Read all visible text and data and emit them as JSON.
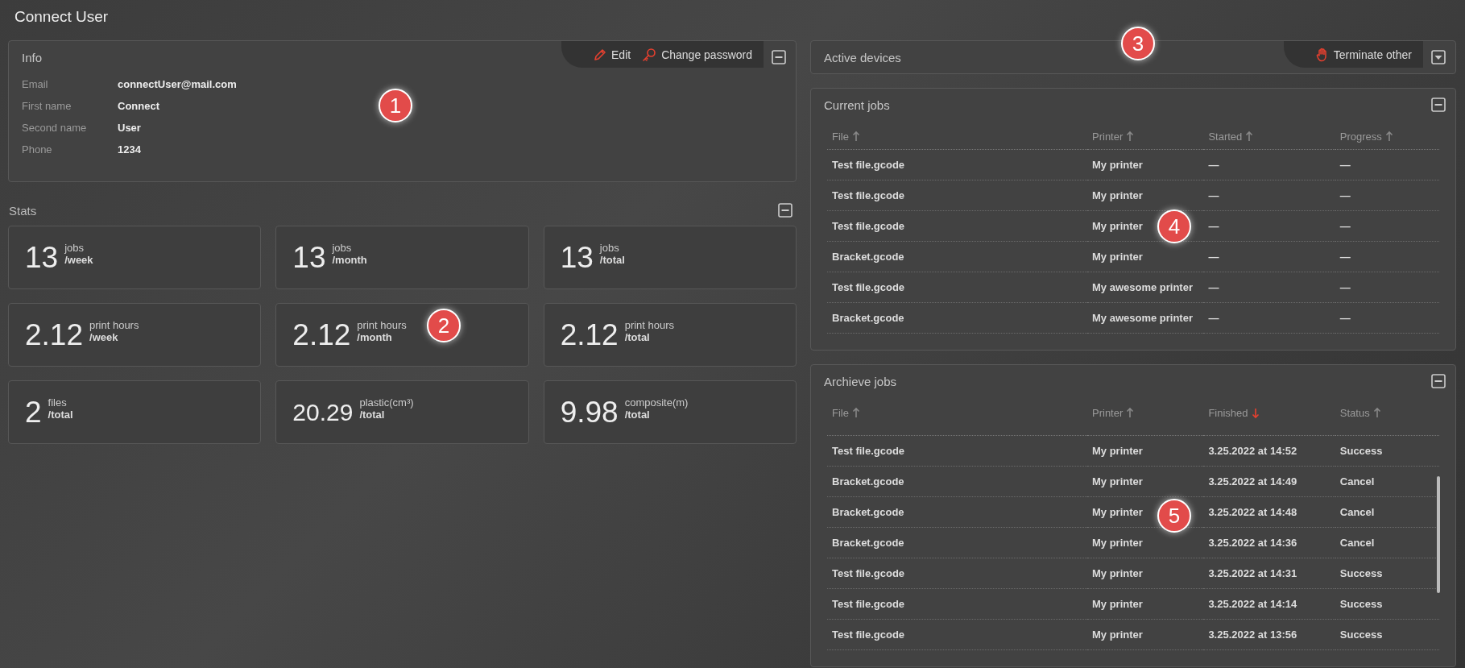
{
  "page": {
    "title": "Connect User"
  },
  "info": {
    "title": "Info",
    "callout": "1",
    "actions": [
      {
        "kind": "edit",
        "label": "Edit"
      },
      {
        "kind": "password",
        "label": "Change password"
      }
    ],
    "expanded": true,
    "fields": [
      {
        "label": "Email",
        "value": "connectUser@mail.com"
      },
      {
        "label": "First name",
        "value": "Connect"
      },
      {
        "label": "Second name",
        "value": "User"
      },
      {
        "label": "Phone",
        "value": "1234"
      }
    ]
  },
  "stats": {
    "title": "Stats",
    "callout": "2",
    "expanded": true,
    "cards": [
      {
        "value": "13",
        "unit": "jobs",
        "period": "/week"
      },
      {
        "value": "13",
        "unit": "jobs",
        "period": "/month"
      },
      {
        "value": "13",
        "unit": "jobs",
        "period": "/total"
      },
      {
        "value": "2.12",
        "unit": "print hours",
        "period": "/week"
      },
      {
        "value": "2.12",
        "unit": "print hours",
        "period": "/month"
      },
      {
        "value": "2.12",
        "unit": "print hours",
        "period": "/total"
      },
      {
        "value": "2",
        "unit": "files",
        "period": "/total"
      },
      {
        "value": "20.29",
        "unit": "plastic(cm³)",
        "period": "/total",
        "small": true
      },
      {
        "value": "9.98",
        "unit": "composite(m)",
        "period": "/total"
      }
    ]
  },
  "active_devices": {
    "title": "Active devices",
    "callout": "3",
    "expanded": false,
    "actions": [
      {
        "kind": "terminate",
        "label": "Terminate other"
      }
    ]
  },
  "current_jobs": {
    "title": "Current jobs",
    "callout": "4",
    "expanded": true,
    "columns": [
      {
        "label": "File",
        "descending": false,
        "sort_active": false
      },
      {
        "label": "Printer",
        "descending": false,
        "sort_active": false
      },
      {
        "label": "Started",
        "descending": false,
        "sort_active": false
      },
      {
        "label": "Progress",
        "descending": false,
        "sort_active": false
      }
    ],
    "rows": [
      [
        "Test file.gcode",
        "My printer",
        "—",
        "—"
      ],
      [
        "Test file.gcode",
        "My printer",
        "—",
        "—"
      ],
      [
        "Test file.gcode",
        "My printer",
        "—",
        "—"
      ],
      [
        "Bracket.gcode",
        "My printer",
        "—",
        "—"
      ],
      [
        "Test file.gcode",
        "My awesome printer",
        "—",
        "—"
      ],
      [
        "Bracket.gcode",
        "My awesome printer",
        "—",
        "—"
      ]
    ]
  },
  "archive_jobs": {
    "title": "Archieve jobs",
    "callout": "5",
    "expanded": true,
    "columns": [
      {
        "label": "File",
        "descending": false,
        "sort_active": false
      },
      {
        "label": "Printer",
        "descending": false,
        "sort_active": false
      },
      {
        "label": "Finished",
        "descending": true,
        "sort_active": true
      },
      {
        "label": "Status",
        "descending": false,
        "sort_active": false
      }
    ],
    "rows": [
      [
        "Test file.gcode",
        "My printer",
        "3.25.2022 at 14:52",
        "Success"
      ],
      [
        "Bracket.gcode",
        "My printer",
        "3.25.2022 at 14:49",
        "Cancel"
      ],
      [
        "Bracket.gcode",
        "My printer",
        "3.25.2022 at 14:48",
        "Cancel"
      ],
      [
        "Bracket.gcode",
        "My printer",
        "3.25.2022 at 14:36",
        "Cancel"
      ],
      [
        "Test file.gcode",
        "My printer",
        "3.25.2022 at 14:31",
        "Success"
      ],
      [
        "Test file.gcode",
        "My printer",
        "3.25.2022 at 14:14",
        "Success"
      ],
      [
        "Test file.gcode",
        "My printer",
        "3.25.2022 at 13:56",
        "Success"
      ]
    ]
  }
}
